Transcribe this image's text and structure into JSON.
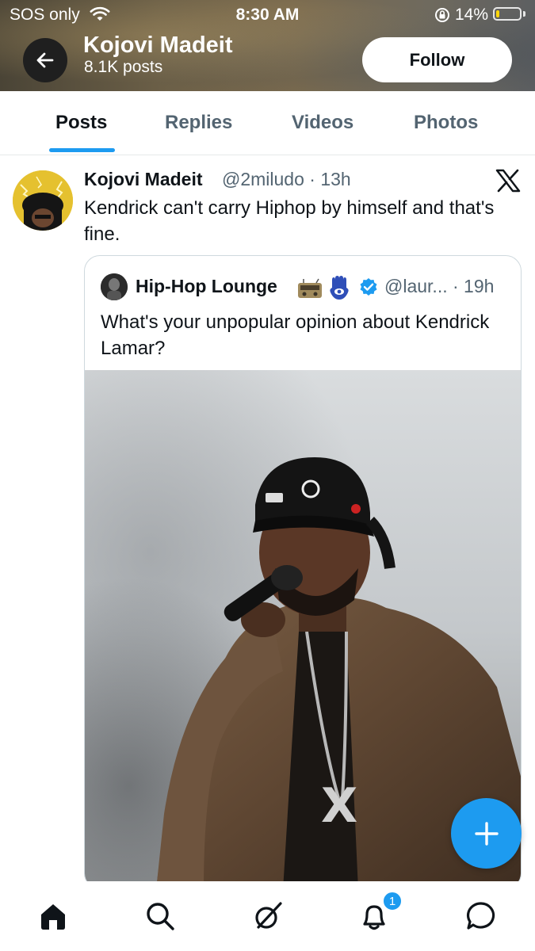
{
  "status_bar": {
    "carrier": "SOS only",
    "time": "8:30 AM",
    "battery": "14%"
  },
  "header": {
    "name": "Kojovi Madeit",
    "post_count": "8.1K posts",
    "follow_label": "Follow"
  },
  "tabs": [
    {
      "label": "Posts",
      "active": true
    },
    {
      "label": "Replies",
      "active": false
    },
    {
      "label": "Videos",
      "active": false
    },
    {
      "label": "Photos",
      "active": false
    }
  ],
  "tweet": {
    "name": "Kojovi Madeit",
    "handle_time": "@2miludo · 13h",
    "text": "Kendrick can't carry Hiphop by himself and that's fine.",
    "quote": {
      "name": "Hip-Hop Lounge",
      "handle_time": "@laur... · 19h",
      "text": "What's your unpopular opinion about Kendrick Lamar?",
      "image_icon": "performer-photo"
    }
  },
  "bottom_nav": {
    "items": [
      "home-icon",
      "search-icon",
      "grok-icon",
      "notifications-icon",
      "messages-icon"
    ],
    "notification_count": "1"
  },
  "colors": {
    "accent": "#1d9bf0",
    "text": "#0f1419",
    "secondary": "#536471"
  }
}
